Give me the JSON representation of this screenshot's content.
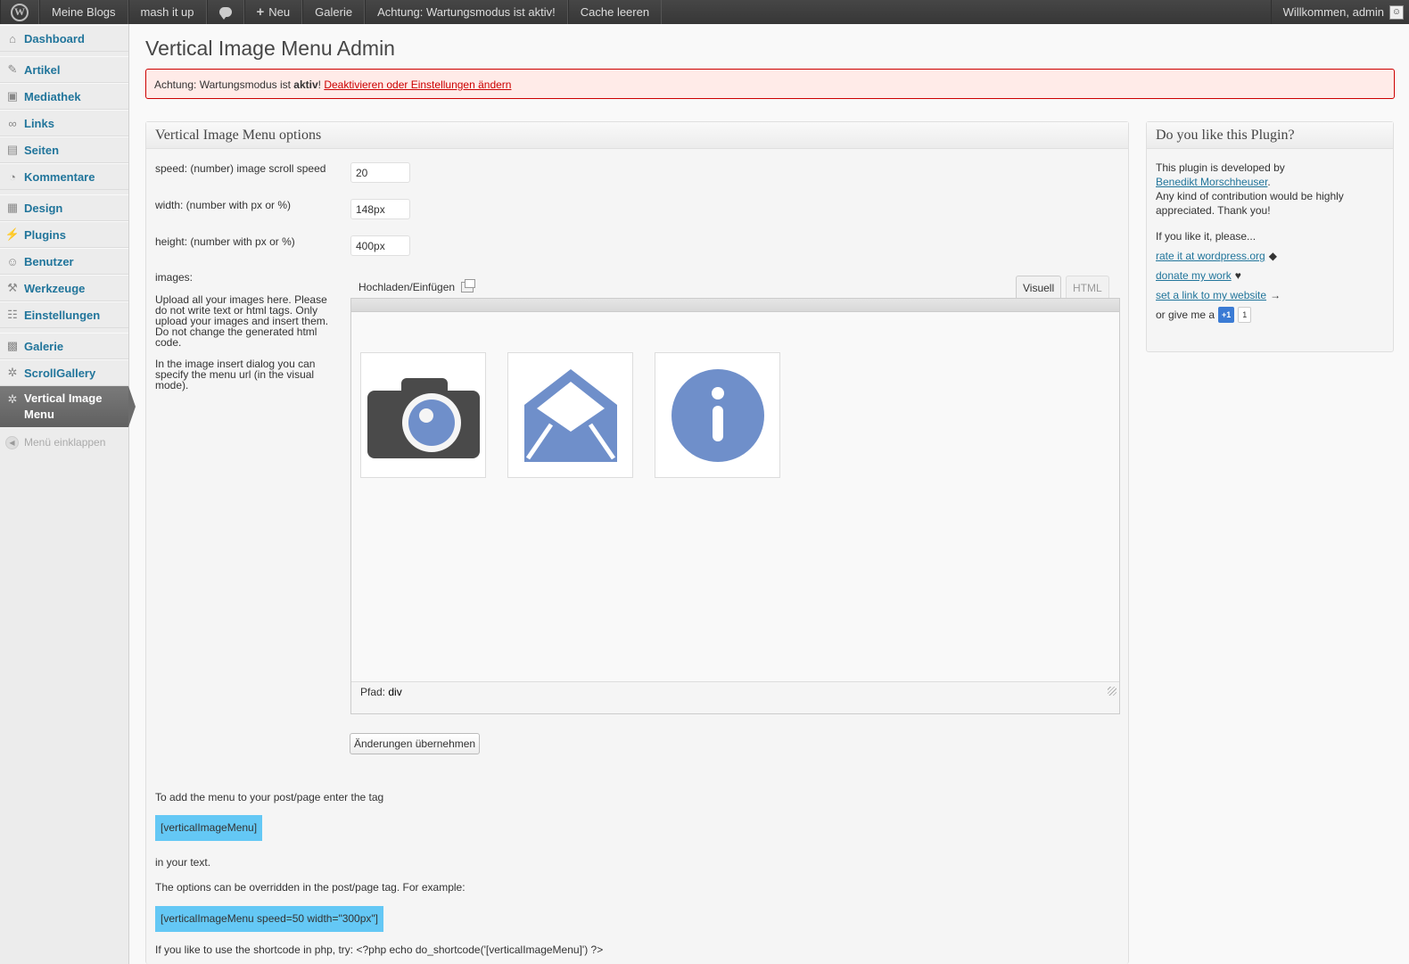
{
  "adminbar": {
    "items": [
      "Meine Blogs",
      "mash it up",
      "Neu",
      "Galerie",
      "Achtung: Wartungsmodus ist aktiv!",
      "Cache leeren"
    ],
    "welcome": "Willkommen, admin"
  },
  "sidebar": {
    "items": [
      {
        "label": "Dashboard",
        "icon": "dashboard-icon"
      },
      {
        "label": "Artikel",
        "icon": "pin-icon"
      },
      {
        "label": "Mediathek",
        "icon": "media-icon"
      },
      {
        "label": "Links",
        "icon": "link-icon"
      },
      {
        "label": "Seiten",
        "icon": "pages-icon"
      },
      {
        "label": "Kommentare",
        "icon": "comments-icon"
      },
      {
        "label": "Design",
        "icon": "appearance-icon"
      },
      {
        "label": "Plugins",
        "icon": "plugins-icon"
      },
      {
        "label": "Benutzer",
        "icon": "users-icon"
      },
      {
        "label": "Werkzeuge",
        "icon": "tools-icon"
      },
      {
        "label": "Einstellungen",
        "icon": "settings-icon"
      },
      {
        "label": "Galerie",
        "icon": "gallery-icon"
      },
      {
        "label": "ScrollGallery",
        "icon": "gear-icon"
      },
      {
        "label": "Vertical Image Menu",
        "icon": "gear-icon"
      }
    ],
    "collapse": "Menü einklappen"
  },
  "page": {
    "title": "Vertical Image Menu Admin",
    "notice_prefix": "Achtung: Wartungsmodus ist ",
    "notice_bold": "aktiv",
    "notice_suffix": "! ",
    "notice_link": "Deaktivieren oder Einstellungen ändern"
  },
  "options": {
    "heading": "Vertical Image Menu options",
    "speed_label": "speed: (number) image scroll speed",
    "speed_value": "20",
    "width_label": "width: (number with px or %)",
    "width_value": "148px",
    "height_label": "height: (number with px or %)",
    "height_value": "400px",
    "images_label": "images:",
    "images_desc1": "Upload all your images here. Please do not write text or html tags. Only upload your images and insert them. Do not change the generated html code.",
    "images_desc2": "In the image insert dialog you can specify the menu url (in the visual mode)."
  },
  "editor": {
    "upload_label": "Hochladen/Einfügen",
    "tab_visual": "Visuell",
    "tab_html": "HTML",
    "path_label": "Pfad:",
    "path_value": "div",
    "images": [
      "camera-icon",
      "envelope-icon",
      "info-icon"
    ],
    "accent": "#6f8fca",
    "dark": "#4a4a4a"
  },
  "save_label": "Änderungen übernehmen",
  "usage": {
    "line1": "To add the menu to your post/page enter the tag",
    "tag1": "[verticalImageMenu]",
    "line2": "in your text.",
    "line3": "The options can be overridden in the post/page tag. For example:",
    "tag2": "[verticalImageMenu speed=50 width=\"300px\"]",
    "line4": "If you like to use the shortcode in php, try: <?php echo do_shortcode('[verticalImageMenu]') ?>"
  },
  "side": {
    "heading": "Do you like this Plugin?",
    "dev_text": "This plugin is developed by",
    "dev_link": "Benedikt Morschheuser",
    "dev_after": ".",
    "contrib": "Any kind of contribution would be highly appreciated. Thank you!",
    "please": "If you like it, please...",
    "rate_link": "rate it at wordpress.org",
    "donate_link": "donate my work",
    "link_link": "set a link to my website",
    "give": "or give me a",
    "gplus": "+1",
    "gplus_count": "1"
  }
}
